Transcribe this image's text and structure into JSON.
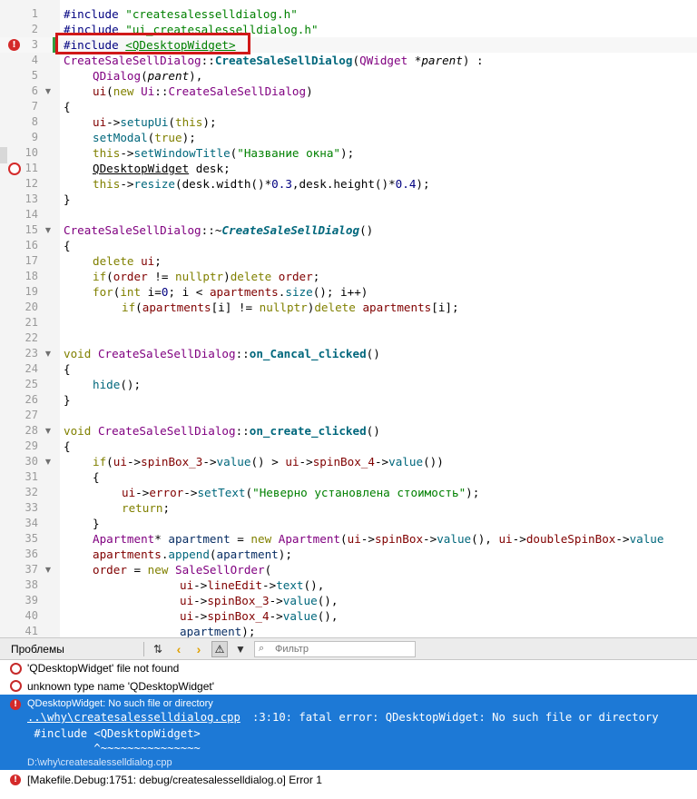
{
  "editor": {
    "lines": [
      {
        "n": "1",
        "fold": "",
        "mark": ""
      },
      {
        "n": "2",
        "fold": "",
        "mark": ""
      },
      {
        "n": "3",
        "fold": "",
        "mark": "error"
      },
      {
        "n": "4",
        "fold": "",
        "mark": ""
      },
      {
        "n": "5",
        "fold": "",
        "mark": ""
      },
      {
        "n": "6",
        "fold": "▼",
        "mark": ""
      },
      {
        "n": "7",
        "fold": "",
        "mark": ""
      },
      {
        "n": "8",
        "fold": "",
        "mark": ""
      },
      {
        "n": "9",
        "fold": "",
        "mark": ""
      },
      {
        "n": "10",
        "fold": "",
        "mark": ""
      },
      {
        "n": "11",
        "fold": "",
        "mark": "warning"
      },
      {
        "n": "12",
        "fold": "",
        "mark": ""
      },
      {
        "n": "13",
        "fold": "",
        "mark": ""
      },
      {
        "n": "14",
        "fold": "",
        "mark": ""
      },
      {
        "n": "15",
        "fold": "▼",
        "mark": ""
      },
      {
        "n": "16",
        "fold": "",
        "mark": ""
      },
      {
        "n": "17",
        "fold": "",
        "mark": ""
      },
      {
        "n": "18",
        "fold": "",
        "mark": ""
      },
      {
        "n": "19",
        "fold": "",
        "mark": ""
      },
      {
        "n": "20",
        "fold": "",
        "mark": ""
      },
      {
        "n": "21",
        "fold": "",
        "mark": ""
      },
      {
        "n": "22",
        "fold": "",
        "mark": ""
      },
      {
        "n": "23",
        "fold": "▼",
        "mark": ""
      },
      {
        "n": "24",
        "fold": "",
        "mark": ""
      },
      {
        "n": "25",
        "fold": "",
        "mark": ""
      },
      {
        "n": "26",
        "fold": "",
        "mark": ""
      },
      {
        "n": "27",
        "fold": "",
        "mark": ""
      },
      {
        "n": "28",
        "fold": "▼",
        "mark": ""
      },
      {
        "n": "29",
        "fold": "",
        "mark": ""
      },
      {
        "n": "30",
        "fold": "▼",
        "mark": ""
      },
      {
        "n": "31",
        "fold": "",
        "mark": ""
      },
      {
        "n": "32",
        "fold": "",
        "mark": ""
      },
      {
        "n": "33",
        "fold": "",
        "mark": ""
      },
      {
        "n": "34",
        "fold": "",
        "mark": ""
      },
      {
        "n": "35",
        "fold": "",
        "mark": ""
      },
      {
        "n": "36",
        "fold": "",
        "mark": ""
      },
      {
        "n": "37",
        "fold": "▼",
        "mark": ""
      },
      {
        "n": "38",
        "fold": "",
        "mark": ""
      },
      {
        "n": "39",
        "fold": "",
        "mark": ""
      },
      {
        "n": "40",
        "fold": "",
        "mark": ""
      },
      {
        "n": "41",
        "fold": "",
        "mark": ""
      }
    ],
    "code": {
      "l1a": "#include ",
      "l1b": "\"createsalesselldialog.h\"",
      "l2a": "#include ",
      "l2b": "\"ui_createsalesselldialog.h\"",
      "l3a": "#include ",
      "l3b": "<QDesktopWidget>",
      "l4a": "CreateSaleSellDialog",
      "l4b": "::",
      "l4c": "CreateSaleSellDialog",
      "l4d": "(",
      "l4e": "QWidget",
      "l4f": " *",
      "l4g": "parent",
      "l4h": ") :",
      "l5a": "QDialog",
      "l5b": "(",
      "l5c": "parent",
      "l5d": "),",
      "l6a": "ui",
      "l6b": "(",
      "l6c": "new",
      "l6d": " ",
      "l6e": "Ui",
      "l6f": "::",
      "l6g": "CreateSaleSellDialog",
      "l6h": ")",
      "l7": "{",
      "l8a": "ui",
      "l8b": "->",
      "l8c": "setupUi",
      "l8d": "(",
      "l8e": "this",
      "l8f": ");",
      "l9a": "setModal",
      "l9b": "(",
      "l9c": "true",
      "l9d": ");",
      "l10a": "this",
      "l10b": "->",
      "l10c": "setWindowTitle",
      "l10d": "(",
      "l10e": "\"Название окна\"",
      "l10f": ");",
      "l11a": "QDesktopWidget",
      "l11b": " desk;",
      "l12a": "this",
      "l12b": "->",
      "l12c": "resize",
      "l12d": "(desk.width()*",
      "l12e": "0.3",
      "l12f": ",desk.height()*",
      "l12g": "0.4",
      "l12h": ");",
      "l13": "}",
      "l15a": "CreateSaleSellDialog",
      "l15b": "::~",
      "l15c": "CreateSaleSellDialog",
      "l15d": "()",
      "l16": "{",
      "l17a": "delete",
      "l17b": " ",
      "l17c": "ui",
      "l17d": ";",
      "l18a": "if",
      "l18b": "(",
      "l18c": "order",
      "l18d": " != ",
      "l18e": "nullptr",
      "l18f": ")",
      "l18g": "delete",
      "l18h": " ",
      "l18i": "order",
      "l18j": ";",
      "l19a": "for",
      "l19b": "(",
      "l19c": "int",
      "l19d": " i=",
      "l19e": "0",
      "l19f": "; i < ",
      "l19g": "apartments",
      "l19h": ".",
      "l19i": "size",
      "l19j": "(); i++)",
      "l20a": "if",
      "l20b": "(",
      "l20c": "apartments",
      "l20d": "[i] != ",
      "l20e": "nullptr",
      "l20f": ")",
      "l20g": "delete",
      "l20h": " ",
      "l20i": "apartments",
      "l20j": "[i];",
      "l23a": "void",
      "l23b": " ",
      "l23c": "CreateSaleSellDialog",
      "l23d": "::",
      "l23e": "on_Cancal_clicked",
      "l23f": "()",
      "l24": "{",
      "l25a": "hide",
      "l25b": "();",
      "l26": "}",
      "l28a": "void",
      "l28b": " ",
      "l28c": "CreateSaleSellDialog",
      "l28d": "::",
      "l28e": "on_create_clicked",
      "l28f": "()",
      "l29": "{",
      "l30a": "if",
      "l30b": "(",
      "l30c": "ui",
      "l30d": "->",
      "l30e": "spinBox_3",
      "l30f": "->",
      "l30g": "value",
      "l30h": "() > ",
      "l30i": "ui",
      "l30j": "->",
      "l30k": "spinBox_4",
      "l30l": "->",
      "l30m": "value",
      "l30n": "())",
      "l31": "{",
      "l32a": "ui",
      "l32b": "->",
      "l32c": "error",
      "l32d": "->",
      "l32e": "setText",
      "l32f": "(",
      "l32g": "\"Неверно установлена стоимость\"",
      "l32h": ");",
      "l33a": "return",
      "l33b": ";",
      "l34": "}",
      "l35a": "Apartment",
      "l35b": "* ",
      "l35c": "apartment",
      "l35d": " = ",
      "l35e": "new",
      "l35f": " ",
      "l35g": "Apartment",
      "l35h": "(",
      "l35i": "ui",
      "l35j": "->",
      "l35k": "spinBox",
      "l35l": "->",
      "l35m": "value",
      "l35n": "(), ",
      "l35o": "ui",
      "l35p": "->",
      "l35q": "doubleSpinBox",
      "l35r": "->",
      "l35s": "value",
      "l36a": "apartments",
      "l36b": ".",
      "l36c": "append",
      "l36d": "(",
      "l36e": "apartment",
      "l36f": ");",
      "l37a": "order",
      "l37b": " = ",
      "l37c": "new",
      "l37d": " ",
      "l37e": "SaleSellOrder",
      "l37f": "(",
      "l38a": "ui",
      "l38b": "->",
      "l38c": "lineEdit",
      "l38d": "->",
      "l38e": "text",
      "l38f": "(),",
      "l39a": "ui",
      "l39b": "->",
      "l39c": "spinBox_3",
      "l39d": "->",
      "l39e": "value",
      "l39f": "(),",
      "l40a": "ui",
      "l40b": "->",
      "l40c": "spinBox_4",
      "l40d": "->",
      "l40e": "value",
      "l40f": "(),",
      "l41a": "apartment",
      "l41b": ");"
    }
  },
  "problems": {
    "title": "Проблемы",
    "filter_placeholder": "Фильтр",
    "filter_icon": "magnifier-icon",
    "toolbar_icons": [
      "sort-icon",
      "prev-arrow-icon",
      "next-arrow-icon",
      "warning-filter-icon",
      "funnel-icon"
    ],
    "items": [
      {
        "text": "'QDesktopWidget' file not found",
        "icon": "error-ring-icon"
      },
      {
        "text": "unknown type name 'QDesktopWidget'",
        "icon": "error-ring-icon"
      },
      {
        "icon": "error-solid-icon",
        "text": "QDesktopWidget: No such file or directory",
        "link": "..\\why\\createsalesselldialog.cpp",
        "detail": ":3:10: fatal error: QDesktopWidget: No such file or directory",
        "src": " #include <QDesktopWidget>",
        "caret": "          ^~~~~~~~~~~~~~~~",
        "path": "D:\\why\\createsalesselldialog.cpp"
      },
      {
        "text": "[Makefile.Debug:1751: debug/createsalesselldialog.o] Error 1",
        "icon": "error-solid-icon"
      }
    ]
  },
  "colors": {
    "error": "#d42a2a",
    "selection": "#1d79d6",
    "annotation_box": "#d01818"
  }
}
